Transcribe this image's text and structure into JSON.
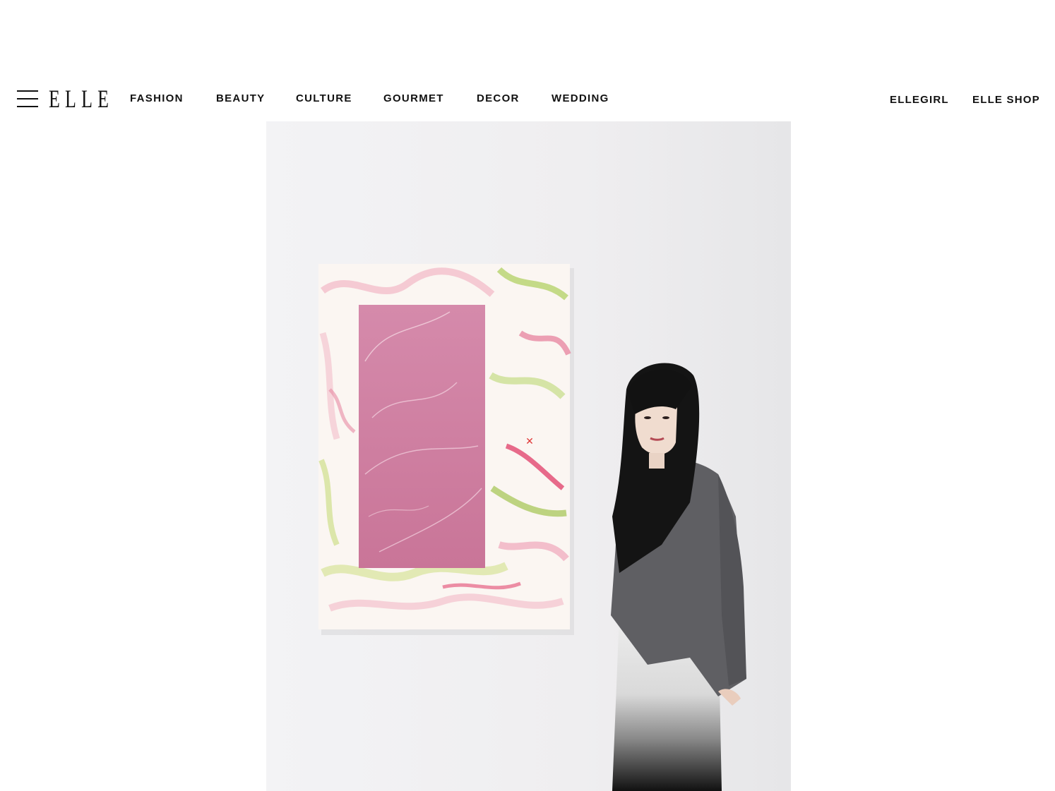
{
  "header": {
    "logo": "ELLE",
    "nav": [
      {
        "label": "FASHION"
      },
      {
        "label": "BEAUTY"
      },
      {
        "label": "CULTURE"
      },
      {
        "label": "GOURMET"
      },
      {
        "label": "DECOR"
      },
      {
        "label": "WEDDING"
      }
    ],
    "right_links": [
      {
        "label": "ELLEGIRL"
      },
      {
        "label": "ELLE SHOP"
      }
    ]
  },
  "hero": {
    "overlay_icon": "close-icon",
    "overlay_glyph": "✕",
    "colors": {
      "wall": "#f0eff1",
      "canvas_pink": "#d07fa3",
      "sweater": "#5f5f63",
      "hair": "#141414"
    }
  }
}
